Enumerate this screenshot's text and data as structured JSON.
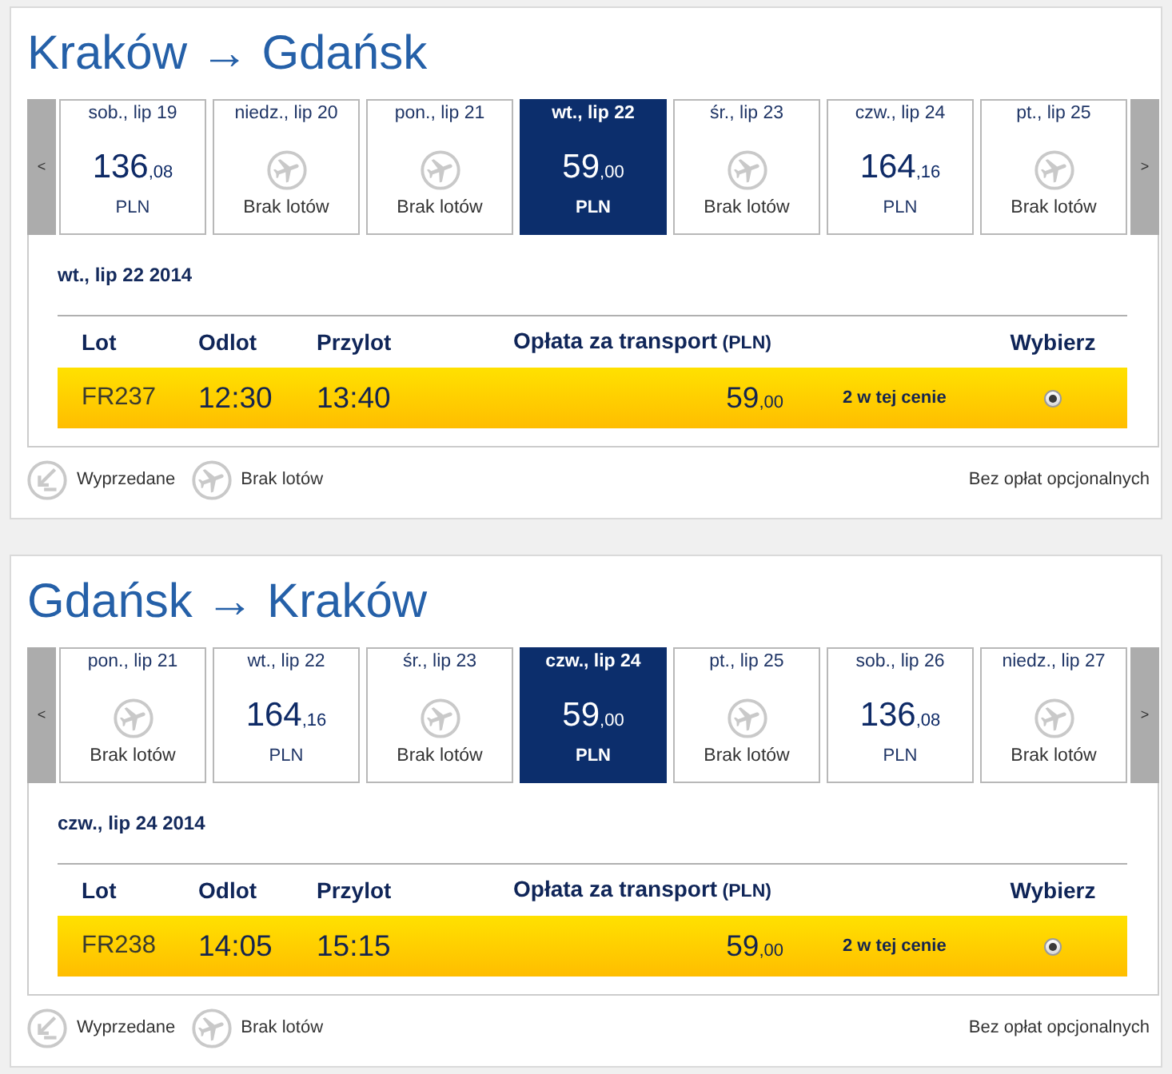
{
  "routes": [
    {
      "title": "Kraków → Gdańsk",
      "prev": "<",
      "next": ">",
      "days": [
        {
          "kind": "price",
          "label": "sob., lip 19",
          "price": "136",
          "fraction": ",08",
          "currency": "PLN",
          "selected": false
        },
        {
          "kind": "none",
          "label": "niedz., lip 20",
          "text": "Brak lotów",
          "selected": false
        },
        {
          "kind": "none",
          "label": "pon., lip 21",
          "text": "Brak lotów",
          "selected": false
        },
        {
          "kind": "price",
          "label": "wt., lip 22",
          "price": "59",
          "fraction": ",00",
          "currency": "PLN",
          "selected": true
        },
        {
          "kind": "none",
          "label": "śr., lip 23",
          "text": "Brak lotów",
          "selected": false
        },
        {
          "kind": "price",
          "label": "czw., lip 24",
          "price": "164",
          "fraction": ",16",
          "currency": "PLN",
          "selected": false
        },
        {
          "kind": "none",
          "label": "pt., lip 25",
          "text": "Brak lotów",
          "selected": false
        }
      ],
      "date": "wt., lip 22 2014",
      "columns": [
        {
          "label": "Lot"
        },
        {
          "label": "Odlot"
        },
        {
          "label": "Przylot"
        },
        {
          "label": "Opłata za transport",
          "unit": "(PLN)"
        },
        {
          "label": "Wybierz"
        }
      ],
      "flights": [
        {
          "number": "FR237",
          "departure": "12:30",
          "arrival": "13:40",
          "price": "59",
          "fraction": ",00",
          "note": "2 w tej cenie",
          "selected": true
        }
      ],
      "legend": [
        {
          "kind": "sold_out",
          "label": "Wyprzedane"
        },
        {
          "kind": "no_flights",
          "label": "Brak lotów"
        }
      ],
      "fare_note": "Bez opłat opcjonalnych"
    },
    {
      "title": "Gdańsk → Kraków",
      "prev": "<",
      "next": ">",
      "days": [
        {
          "kind": "none",
          "label": "pon., lip 21",
          "text": "Brak lotów",
          "selected": false
        },
        {
          "kind": "price",
          "label": "wt., lip 22",
          "price": "164",
          "fraction": ",16",
          "currency": "PLN",
          "selected": false
        },
        {
          "kind": "none",
          "label": "śr., lip 23",
          "text": "Brak lotów",
          "selected": false
        },
        {
          "kind": "price",
          "label": "czw., lip 24",
          "price": "59",
          "fraction": ",00",
          "currency": "PLN",
          "selected": true
        },
        {
          "kind": "none",
          "label": "pt., lip 25",
          "text": "Brak lotów",
          "selected": false
        },
        {
          "kind": "price",
          "label": "sob., lip 26",
          "price": "136",
          "fraction": ",08",
          "currency": "PLN",
          "selected": false
        },
        {
          "kind": "none",
          "label": "niedz., lip 27",
          "text": "Brak lotów",
          "selected": false
        }
      ],
      "date": "czw., lip 24 2014",
      "columns": [
        {
          "label": "Lot"
        },
        {
          "label": "Odlot"
        },
        {
          "label": "Przylot"
        },
        {
          "label": "Opłata za transport",
          "unit": "(PLN)"
        },
        {
          "label": "Wybierz"
        }
      ],
      "flights": [
        {
          "number": "FR238",
          "departure": "14:05",
          "arrival": "15:15",
          "price": "59",
          "fraction": ",00",
          "note": "2 w tej cenie",
          "selected": true
        }
      ],
      "legend": [
        {
          "kind": "sold_out",
          "label": "Wyprzedane"
        },
        {
          "kind": "no_flights",
          "label": "Brak lotów"
        }
      ],
      "fare_note": "Bez opłat opcjonalnych"
    }
  ]
}
